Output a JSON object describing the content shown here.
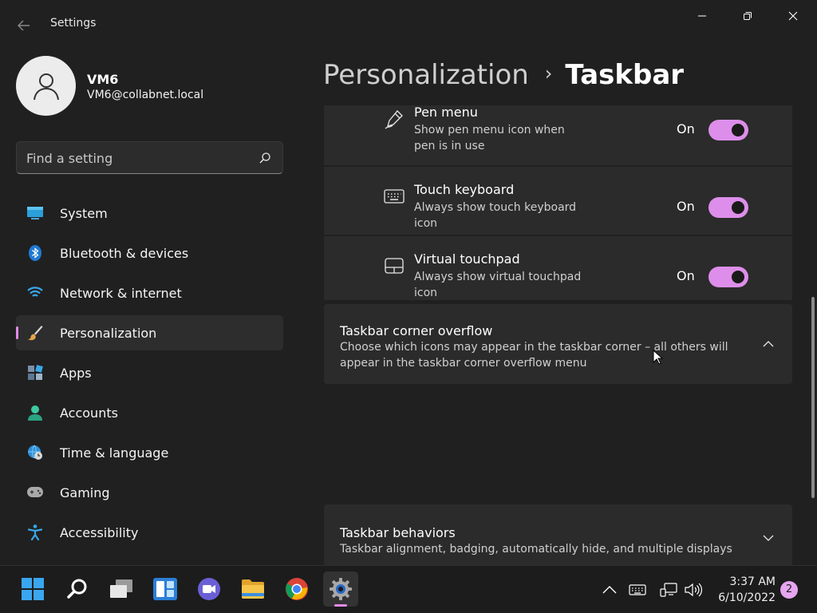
{
  "window": {
    "app_title": "Settings",
    "back_icon": "back-arrow-icon",
    "controls": [
      "minimize-icon",
      "maximize-icon",
      "close-icon"
    ]
  },
  "profile": {
    "name": "VM6",
    "email": "VM6@collabnet.local",
    "avatar_icon": "user-avatar-icon"
  },
  "search": {
    "placeholder": "Find a setting",
    "value": "",
    "icon": "search-icon"
  },
  "sidebar": {
    "selected": "Personalization",
    "items": [
      {
        "label": "System",
        "icon": "system-icon"
      },
      {
        "label": "Bluetooth & devices",
        "icon": "bluetooth-icon"
      },
      {
        "label": "Network & internet",
        "icon": "wifi-icon"
      },
      {
        "label": "Personalization",
        "icon": "brush-icon"
      },
      {
        "label": "Apps",
        "icon": "apps-icon"
      },
      {
        "label": "Accounts",
        "icon": "account-icon"
      },
      {
        "label": "Time & language",
        "icon": "globe-clock-icon"
      },
      {
        "label": "Gaming",
        "icon": "gamepad-icon"
      },
      {
        "label": "Accessibility",
        "icon": "accessibility-icon"
      }
    ]
  },
  "breadcrumb": {
    "parent": "Personalization",
    "separator": "›",
    "current": "Taskbar"
  },
  "settings": {
    "pen_menu": {
      "title": "Pen menu",
      "description": "Show pen menu icon when pen is in use",
      "state": "On",
      "enabled": true,
      "icon": "pen-icon"
    },
    "touch_keyboard": {
      "title": "Touch keyboard",
      "description": "Always show touch keyboard icon",
      "state": "On",
      "enabled": true,
      "icon": "keyboard-icon"
    },
    "virtual_touchpad": {
      "title": "Virtual touchpad",
      "description": "Always show virtual touchpad icon",
      "state": "On",
      "enabled": true,
      "icon": "touchpad-icon"
    },
    "corner_overflow": {
      "title": "Taskbar corner overflow",
      "description": "Choose which icons may appear in the taskbar corner – all others will appear in the taskbar corner overflow menu",
      "expanded": true,
      "icon": "chevron-up-icon"
    },
    "behaviors": {
      "title": "Taskbar behaviors",
      "description": "Taskbar alignment, badging, automatically hide, and multiple displays",
      "expanded": false,
      "icon": "chevron-down-icon"
    }
  },
  "taskbar": {
    "apps": [
      {
        "name": "start",
        "icon": "windows-start-icon"
      },
      {
        "name": "search",
        "icon": "search-icon"
      },
      {
        "name": "task-view",
        "icon": "task-view-icon"
      },
      {
        "name": "widgets",
        "icon": "widgets-icon"
      },
      {
        "name": "chat",
        "icon": "chat-icon"
      },
      {
        "name": "file-explorer",
        "icon": "folder-icon"
      },
      {
        "name": "chrome",
        "icon": "chrome-icon"
      },
      {
        "name": "settings",
        "icon": "gear-icon",
        "active": true
      }
    ],
    "tray": [
      "chevron-up-icon",
      "keyboard-icon",
      "network-icon",
      "volume-icon"
    ],
    "time": "3:37 AM",
    "date": "6/10/2022",
    "notifications": "2"
  },
  "colors": {
    "accent": "#dd8eea",
    "background": "#202020",
    "card": "#2b2b2b"
  }
}
